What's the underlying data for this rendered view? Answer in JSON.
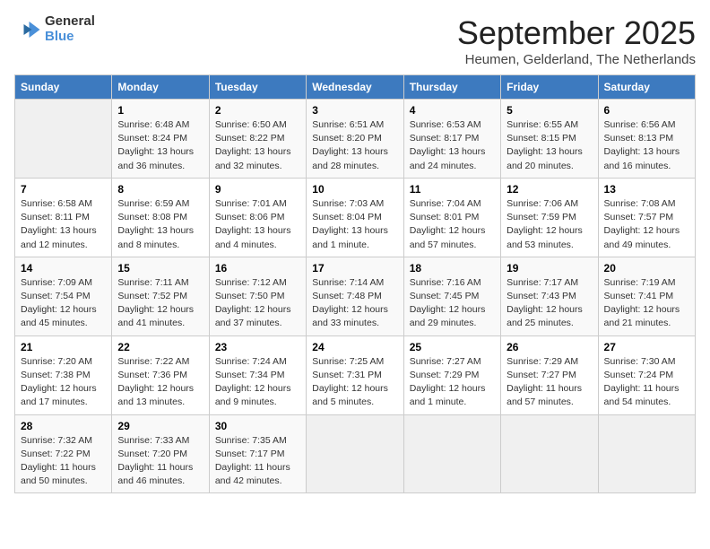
{
  "logo": {
    "line1": "General",
    "line2": "Blue"
  },
  "title": "September 2025",
  "subtitle": "Heumen, Gelderland, The Netherlands",
  "headers": [
    "Sunday",
    "Monday",
    "Tuesday",
    "Wednesday",
    "Thursday",
    "Friday",
    "Saturday"
  ],
  "weeks": [
    [
      {
        "day": "",
        "info": ""
      },
      {
        "day": "1",
        "info": "Sunrise: 6:48 AM\nSunset: 8:24 PM\nDaylight: 13 hours\nand 36 minutes."
      },
      {
        "day": "2",
        "info": "Sunrise: 6:50 AM\nSunset: 8:22 PM\nDaylight: 13 hours\nand 32 minutes."
      },
      {
        "day": "3",
        "info": "Sunrise: 6:51 AM\nSunset: 8:20 PM\nDaylight: 13 hours\nand 28 minutes."
      },
      {
        "day": "4",
        "info": "Sunrise: 6:53 AM\nSunset: 8:17 PM\nDaylight: 13 hours\nand 24 minutes."
      },
      {
        "day": "5",
        "info": "Sunrise: 6:55 AM\nSunset: 8:15 PM\nDaylight: 13 hours\nand 20 minutes."
      },
      {
        "day": "6",
        "info": "Sunrise: 6:56 AM\nSunset: 8:13 PM\nDaylight: 13 hours\nand 16 minutes."
      }
    ],
    [
      {
        "day": "7",
        "info": "Sunrise: 6:58 AM\nSunset: 8:11 PM\nDaylight: 13 hours\nand 12 minutes."
      },
      {
        "day": "8",
        "info": "Sunrise: 6:59 AM\nSunset: 8:08 PM\nDaylight: 13 hours\nand 8 minutes."
      },
      {
        "day": "9",
        "info": "Sunrise: 7:01 AM\nSunset: 8:06 PM\nDaylight: 13 hours\nand 4 minutes."
      },
      {
        "day": "10",
        "info": "Sunrise: 7:03 AM\nSunset: 8:04 PM\nDaylight: 13 hours\nand 1 minute."
      },
      {
        "day": "11",
        "info": "Sunrise: 7:04 AM\nSunset: 8:01 PM\nDaylight: 12 hours\nand 57 minutes."
      },
      {
        "day": "12",
        "info": "Sunrise: 7:06 AM\nSunset: 7:59 PM\nDaylight: 12 hours\nand 53 minutes."
      },
      {
        "day": "13",
        "info": "Sunrise: 7:08 AM\nSunset: 7:57 PM\nDaylight: 12 hours\nand 49 minutes."
      }
    ],
    [
      {
        "day": "14",
        "info": "Sunrise: 7:09 AM\nSunset: 7:54 PM\nDaylight: 12 hours\nand 45 minutes."
      },
      {
        "day": "15",
        "info": "Sunrise: 7:11 AM\nSunset: 7:52 PM\nDaylight: 12 hours\nand 41 minutes."
      },
      {
        "day": "16",
        "info": "Sunrise: 7:12 AM\nSunset: 7:50 PM\nDaylight: 12 hours\nand 37 minutes."
      },
      {
        "day": "17",
        "info": "Sunrise: 7:14 AM\nSunset: 7:48 PM\nDaylight: 12 hours\nand 33 minutes."
      },
      {
        "day": "18",
        "info": "Sunrise: 7:16 AM\nSunset: 7:45 PM\nDaylight: 12 hours\nand 29 minutes."
      },
      {
        "day": "19",
        "info": "Sunrise: 7:17 AM\nSunset: 7:43 PM\nDaylight: 12 hours\nand 25 minutes."
      },
      {
        "day": "20",
        "info": "Sunrise: 7:19 AM\nSunset: 7:41 PM\nDaylight: 12 hours\nand 21 minutes."
      }
    ],
    [
      {
        "day": "21",
        "info": "Sunrise: 7:20 AM\nSunset: 7:38 PM\nDaylight: 12 hours\nand 17 minutes."
      },
      {
        "day": "22",
        "info": "Sunrise: 7:22 AM\nSunset: 7:36 PM\nDaylight: 12 hours\nand 13 minutes."
      },
      {
        "day": "23",
        "info": "Sunrise: 7:24 AM\nSunset: 7:34 PM\nDaylight: 12 hours\nand 9 minutes."
      },
      {
        "day": "24",
        "info": "Sunrise: 7:25 AM\nSunset: 7:31 PM\nDaylight: 12 hours\nand 5 minutes."
      },
      {
        "day": "25",
        "info": "Sunrise: 7:27 AM\nSunset: 7:29 PM\nDaylight: 12 hours\nand 1 minute."
      },
      {
        "day": "26",
        "info": "Sunrise: 7:29 AM\nSunset: 7:27 PM\nDaylight: 11 hours\nand 57 minutes."
      },
      {
        "day": "27",
        "info": "Sunrise: 7:30 AM\nSunset: 7:24 PM\nDaylight: 11 hours\nand 54 minutes."
      }
    ],
    [
      {
        "day": "28",
        "info": "Sunrise: 7:32 AM\nSunset: 7:22 PM\nDaylight: 11 hours\nand 50 minutes."
      },
      {
        "day": "29",
        "info": "Sunrise: 7:33 AM\nSunset: 7:20 PM\nDaylight: 11 hours\nand 46 minutes."
      },
      {
        "day": "30",
        "info": "Sunrise: 7:35 AM\nSunset: 7:17 PM\nDaylight: 11 hours\nand 42 minutes."
      },
      {
        "day": "",
        "info": ""
      },
      {
        "day": "",
        "info": ""
      },
      {
        "day": "",
        "info": ""
      },
      {
        "day": "",
        "info": ""
      }
    ]
  ]
}
